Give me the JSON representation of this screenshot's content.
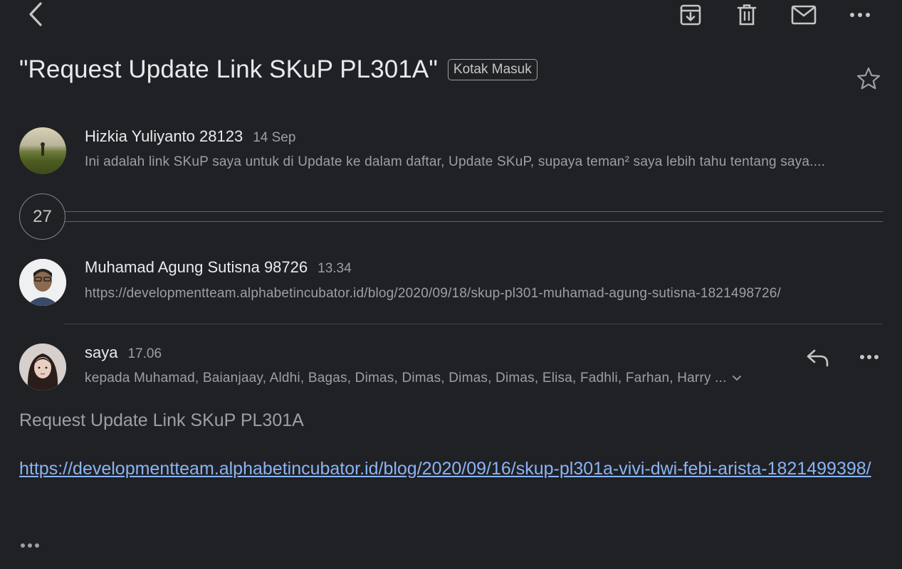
{
  "toolbar": {
    "back_icon": "chevron-left-icon",
    "archive_icon": "archive-icon",
    "delete_icon": "trash-icon",
    "mark_unread_icon": "mail-icon",
    "more_icon": "more-horizontal-icon"
  },
  "thread": {
    "subject": "\"Request Update Link SKuP PL301A\"",
    "label": "Kotak Masuk",
    "star_icon": "star-outline-icon"
  },
  "messages": [
    {
      "sender": "Hizkia Yuliyanto 28123",
      "time": "14 Sep",
      "snippet": "Ini adalah link SKuP saya untuk di Update ke dalam daftar, Update SKuP, supaya teman² saya lebih tahu tentang saya...."
    },
    {
      "sender": "Muhamad Agung Sutisna 98726",
      "time": "13.34",
      "snippet": "https://developmentteam.alphabetincubator.id/blog/2020/09/18/skup-pl301-muhamad-agung-sutisna-1821498726/"
    },
    {
      "sender": "saya",
      "time": "17.06",
      "recipients": "kepada Muhamad, Baianjaay, Aldhi, Bagas, Dimas, Dimas, Dimas, Dimas, Elisa, Fadhli, Farhan, Harry ...",
      "body_text": "Request Update Link SKuP PL301A",
      "body_link": "https://developmentteam.alphabetincubator.id/blog/2020/09/16/skup-pl301a-vivi-dwi-febi-arista-1821499398/"
    }
  ],
  "collapsed_count": "27",
  "colors": {
    "background": "#202124",
    "link": "#8ab4f8",
    "secondary_text": "#9aa0a6"
  }
}
